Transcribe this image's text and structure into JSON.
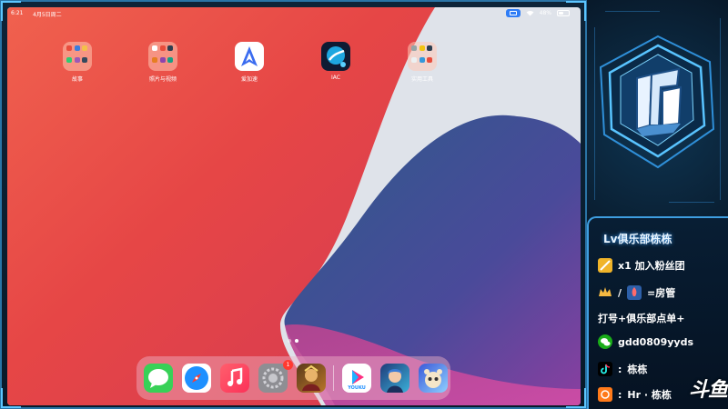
{
  "status_bar": {
    "time": "6:21",
    "date": "4月5日周二",
    "battery_pct": "48%",
    "battery_level": 0.48
  },
  "home_apps": [
    {
      "label": "故事",
      "icon": "folder-icon"
    },
    {
      "label": "照片与视频",
      "icon": "folder-icon"
    },
    {
      "label": "爱加速",
      "icon": "aijiasu-app-icon"
    },
    {
      "label": "IAC",
      "icon": "iac-app-icon"
    },
    {
      "label": "实用工具",
      "icon": "folder-icon"
    }
  ],
  "page_indicator": {
    "pages": 2,
    "current": 2
  },
  "dock": {
    "apps": [
      "messages-icon",
      "safari-icon",
      "music-icon",
      "settings-icon",
      "game-icon",
      "youku-icon",
      "game-character-icon",
      "game-mascot-icon"
    ],
    "settings_badge": "1",
    "youku_text": "YOUKU"
  },
  "side_panel": {
    "title": "Lv俱乐部栋栋",
    "fan_group": "x1 加入粉丝团",
    "room_admin_sep": "/",
    "room_admin": "=房管",
    "club_order": "打号+俱乐部点单+",
    "wechat": "gdd0809yyds",
    "tiktok_prefix": ":",
    "tiktok": "栋栋",
    "hr_prefix": ":",
    "hr": "Hr · 栋栋",
    "watermark": "斗鱼"
  },
  "colors": {
    "accent": "#3e9ee0",
    "badge": "#ff3b30"
  }
}
